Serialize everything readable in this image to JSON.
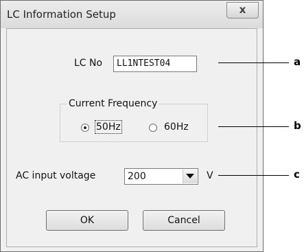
{
  "window": {
    "title": "LC Information Setup",
    "close_label": "x"
  },
  "lc_no": {
    "label": "LC No",
    "value": "LL1NTEST04"
  },
  "frequency": {
    "group_title": "Current Frequency",
    "options": [
      {
        "label": "50Hz",
        "selected": true
      },
      {
        "label": "60Hz",
        "selected": false
      }
    ]
  },
  "ac_voltage": {
    "label": "AC input voltage",
    "value": "200",
    "unit": "V"
  },
  "buttons": {
    "ok": "OK",
    "cancel": "Cancel"
  },
  "callouts": [
    "a",
    "b",
    "c"
  ]
}
